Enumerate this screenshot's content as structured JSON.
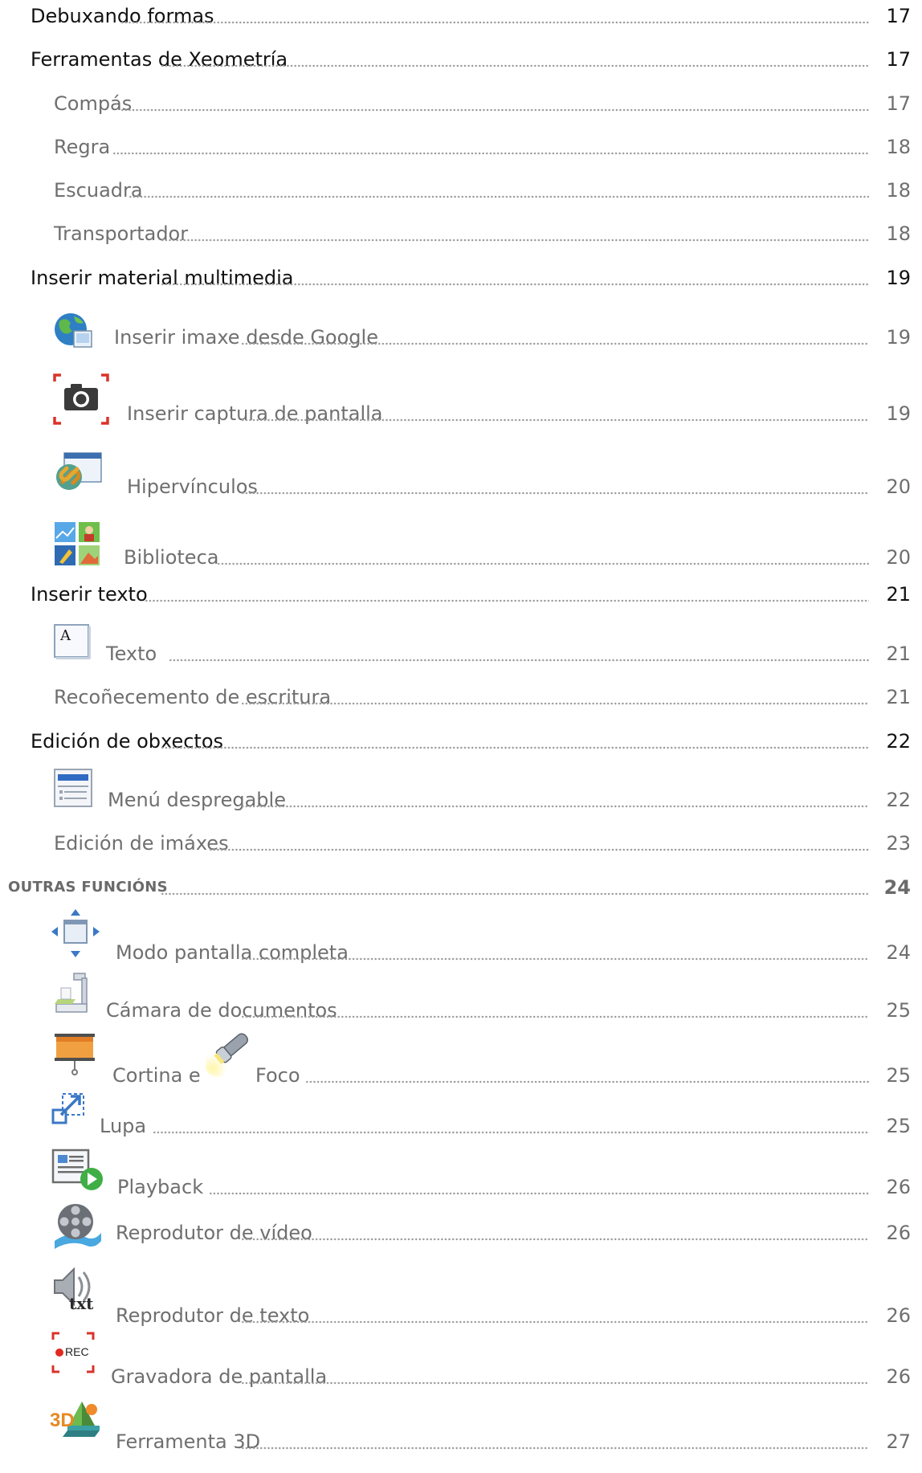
{
  "toc": [
    {
      "label": "Debuxando formas",
      "page": "17",
      "level": 1
    },
    {
      "label": "Ferramentas de Xeometría",
      "page": "17",
      "level": 1
    },
    {
      "label": "Compás",
      "page": "17",
      "level": 2
    },
    {
      "label": "Regra",
      "page": "18",
      "level": 2
    },
    {
      "label": "Escuadra",
      "page": "18",
      "level": 2
    },
    {
      "label": "Transportador",
      "page": "18",
      "level": 2
    },
    {
      "label": "Inserir material multimedia",
      "page": "19",
      "level": 1
    },
    {
      "label": "Inserir imaxe desde Google",
      "page": "19",
      "level": 2,
      "icon": "globe-image-icon"
    },
    {
      "label": "Inserir captura de pantalla",
      "page": "19",
      "level": 2,
      "icon": "camera-capture-icon"
    },
    {
      "label": "Hipervínculos",
      "page": "20",
      "level": 2,
      "icon": "hyperlink-icon"
    },
    {
      "label": "Biblioteca",
      "page": "20",
      "level": 2,
      "icon": "library-icon"
    },
    {
      "label": "Inserir texto",
      "page": "21",
      "level": 1
    },
    {
      "label": "Texto",
      "page": "21",
      "level": 2,
      "icon": "text-box-icon"
    },
    {
      "label": "Recoñecemento de escritura",
      "page": "21",
      "level": 2
    },
    {
      "label": "Edición de obxectos",
      "page": "22",
      "level": 1
    },
    {
      "label": "Menú despregable",
      "page": "22",
      "level": 2,
      "icon": "dropdown-menu-icon"
    },
    {
      "label": "Edición de imáxes",
      "page": "23",
      "level": 2
    },
    {
      "label": "Outras funcións",
      "page": "24",
      "level": 0
    },
    {
      "label": "Modo pantalla completa",
      "page": "24",
      "level": 2,
      "icon": "fullscreen-icon"
    },
    {
      "label": "Cámara de documentos",
      "page": "25",
      "level": 2,
      "icon": "document-camera-icon"
    },
    {
      "label": "Cortina e",
      "label2": "Foco",
      "page": "25",
      "level": 2,
      "icon": "curtain-icon",
      "icon2": "spotlight-icon"
    },
    {
      "label": "Lupa",
      "page": "25",
      "level": 2,
      "icon": "magnifier-icon"
    },
    {
      "label": "Playback",
      "page": "26",
      "level": 2,
      "icon": "playback-icon"
    },
    {
      "label": "Reprodutor de vídeo",
      "page": "26",
      "level": 2,
      "icon": "video-player-icon"
    },
    {
      "label": "Reprodutor de texto",
      "page": "26",
      "level": 2,
      "icon": "text-reader-icon"
    },
    {
      "label": "Gravadora de pantalla",
      "page": "26",
      "level": 2,
      "icon": "screen-recorder-icon",
      "icon_text": "REC"
    },
    {
      "label": "Ferramenta 3D",
      "page": "27",
      "level": 2,
      "icon": "3d-tool-icon",
      "icon_text": "3D"
    }
  ]
}
